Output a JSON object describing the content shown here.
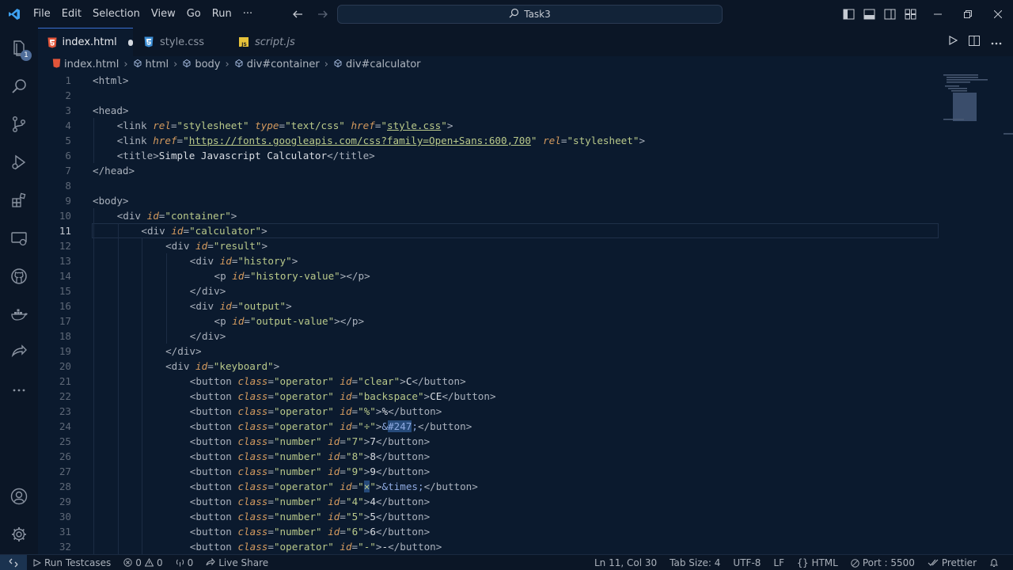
{
  "menu": [
    "File",
    "Edit",
    "Selection",
    "View",
    "Go",
    "Run",
    "···"
  ],
  "command_center": {
    "label": "Task3"
  },
  "activity": {
    "explorer_badge": "1"
  },
  "tabs": [
    {
      "label": "index.html",
      "icon": "html5-icon",
      "active": true,
      "dirty": true
    },
    {
      "label": "style.css",
      "icon": "css3-icon",
      "active": false
    },
    {
      "label": "script.js",
      "icon": "js-icon",
      "active": false
    }
  ],
  "breadcrumbs": [
    "index.html",
    "html",
    "body",
    "div#container",
    "div#calculator"
  ],
  "editor": {
    "current_line": 11,
    "lines": [
      "<html>",
      "",
      "<head>",
      "<link rel=\"stylesheet\" type=\"text/css\" href=\"style.css\">",
      "<link href=\"https://fonts.googleapis.com/css?family=Open+Sans:600,700\" rel=\"stylesheet\">",
      "<title>Simple Javascript Calculator</title>",
      "</head>",
      "",
      "<body>",
      "<div id=\"container\">",
      "<div id=\"calculator\">",
      "<div id=\"result\">",
      "<div id=\"history\">",
      "<p id=\"history-value\"></p>",
      "</div>",
      "<div id=\"output\">",
      "<p id=\"output-value\"></p>",
      "</div>",
      "</div>",
      "<div id=\"keyboard\">",
      "<button class=\"operator\" id=\"clear\">C</button>",
      "<button class=\"operator\" id=\"backspace\">CE</button>",
      "<button class=\"operator\" id=\"%\">%</button>",
      "<button class=\"operator\" id=\"÷\">&#247;</button>",
      "<button class=\"number\" id=\"7\">7</button>",
      "<button class=\"number\" id=\"8\">8</button>",
      "<button class=\"number\" id=\"9\">9</button>",
      "<button class=\"operator\" id=\"×\">&times;</button>",
      "<button class=\"number\" id=\"4\">4</button>",
      "<button class=\"number\" id=\"5\">5</button>",
      "<button class=\"number\" id=\"6\">6</button>",
      "<button class=\"operator\" id=\"-\">-</button>"
    ]
  },
  "statusbar": {
    "run_testcases": "Run Testcases",
    "errors": "0",
    "warnings": "0",
    "ports": "0",
    "live_share": "Live Share",
    "position": "Ln 11, Col 30",
    "tab_size": "Tab Size: 4",
    "encoding": "UTF-8",
    "eol": "LF",
    "language": "HTML",
    "port": "Port : 5500",
    "prettier": "Prettier"
  }
}
